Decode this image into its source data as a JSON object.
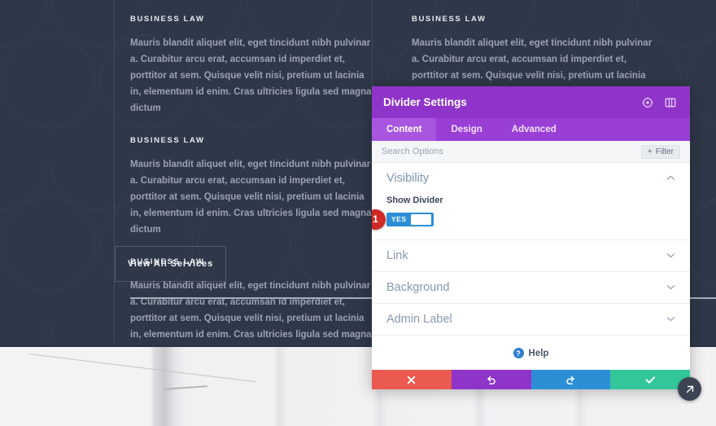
{
  "page": {
    "blocks": [
      {
        "heading": "BUSINESS LAW",
        "body": "Mauris blandit aliquet elit, eget tincidunt nibh pulvinar a. Curabitur arcu erat, accumsan id imperdiet et, porttitor at sem. Quisque velit nisi, pretium ut lacinia in, elementum id enim. Cras ultricies ligula sed magna dictum"
      },
      {
        "heading": "BUSINESS LAW",
        "body": "Mauris blandit aliquet elit, eget tincidunt nibh pulvinar a. Curabitur arcu erat, accumsan id imperdiet et, porttitor at sem. Quisque velit nisi, pretium ut lacinia in, elementum id enim. Cras ultricies ligula sed magna dictum"
      },
      {
        "heading": "BUSINESS LAW",
        "body": "Mauris blandit aliquet elit, eget tincidunt nibh pulvinar a. Curabitur arcu erat, accumsan id imperdiet et, porttitor at sem. Quisque velit nisi, pretium ut lacinia in, elementum id enim. Cras ultricies ligula sed magna dictum"
      }
    ],
    "right_block": {
      "heading": "BUSINESS LAW",
      "body": "Mauris blandit aliquet elit, eget tincidunt nibh pulvinar a. Curabitur arcu erat, accumsan id imperdiet et, porttitor at sem. Quisque velit nisi, pretium ut lacinia in, elementum id enim. Cras ultricies ligula sed magna dictum"
    },
    "cta_label": "View All Services",
    "colors": {
      "background": "#2f3849",
      "divider": "#9fb3bd",
      "heading": "#e8eaee",
      "body": "#9ba3b2"
    }
  },
  "modal": {
    "title": "Divider Settings",
    "header_icons": [
      {
        "name": "expand-icon"
      },
      {
        "name": "panel-layout-icon"
      }
    ],
    "tabs": [
      {
        "label": "Content",
        "active": true
      },
      {
        "label": "Design",
        "active": false
      },
      {
        "label": "Advanced",
        "active": false
      }
    ],
    "search": {
      "placeholder": "Search Options",
      "value": "",
      "filter_label": "Filter",
      "filter_plus": "+"
    },
    "sections": [
      {
        "title": "Visibility",
        "expanded": true,
        "chevron": "⌃"
      },
      {
        "title": "Link",
        "expanded": false,
        "chevron": "⌄"
      },
      {
        "title": "Background",
        "expanded": false,
        "chevron": "⌄"
      },
      {
        "title": "Admin Label",
        "expanded": false,
        "chevron": "⌄"
      }
    ],
    "visibility": {
      "field_label": "Show Divider",
      "toggle_value": "YES",
      "badge_number": "1"
    },
    "help": {
      "label": "Help",
      "icon_glyph": "?"
    },
    "footer_buttons": [
      {
        "name": "cancel-button",
        "glyph": "✖",
        "color": "#eb5a51"
      },
      {
        "name": "undo-button",
        "glyph": "↺",
        "color": "#8f34c9"
      },
      {
        "name": "redo-button",
        "glyph": "↻",
        "color": "#2c8fd6"
      },
      {
        "name": "save-button",
        "glyph": "✔",
        "color": "#33c69a"
      }
    ],
    "drag_handle_glyph": "⤡",
    "colors": {
      "header": "#8f34c9",
      "tabbar": "#9a3fd6",
      "tab_active": "#a855e0",
      "toggle_on": "#2c8fd6",
      "badge": "#d02a24"
    }
  }
}
